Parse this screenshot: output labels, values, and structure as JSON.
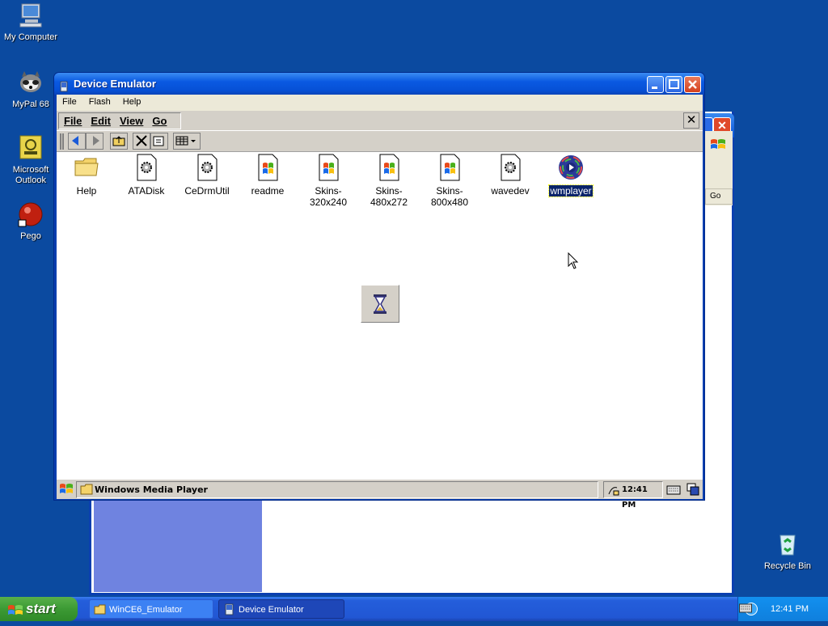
{
  "desktop": {
    "icons": [
      {
        "label": "My Computer"
      },
      {
        "label": "MyPal 68"
      },
      {
        "label": "Microsoft Outlook"
      },
      {
        "label": "Pego"
      },
      {
        "label": "Recycle Bin"
      }
    ]
  },
  "background_window": {
    "go_label": "Go"
  },
  "window": {
    "title": "Device Emulator",
    "menu": [
      "File",
      "Flash",
      "Help"
    ]
  },
  "ce_explorer": {
    "menu": [
      "File",
      "Edit",
      "View",
      "Go"
    ],
    "files": [
      {
        "name": "Help",
        "type": "folder"
      },
      {
        "name": "ATADisk",
        "type": "app"
      },
      {
        "name": "CeDrmUtil",
        "type": "app"
      },
      {
        "name": "readme",
        "type": "doc"
      },
      {
        "name": "Skins-\n320x240",
        "type": "doc"
      },
      {
        "name": "Skins-\n480x272",
        "type": "doc"
      },
      {
        "name": "Skins-\n800x480",
        "type": "doc"
      },
      {
        "name": "wavedev",
        "type": "app"
      },
      {
        "name": "wmplayer",
        "type": "media",
        "selected": true
      }
    ],
    "taskbar_item": "Windows Media Player",
    "clock": "12:41 PM"
  },
  "taskbar": {
    "start_label": "start",
    "tasks": [
      {
        "label": "WinCE6_Emulator",
        "active": false
      },
      {
        "label": "Device Emulator",
        "active": true
      }
    ],
    "clock": "12:41 PM"
  },
  "colors": {
    "desktop": "#0b4aa0",
    "selection": "#0a246a",
    "taskbar": "#245edb"
  }
}
